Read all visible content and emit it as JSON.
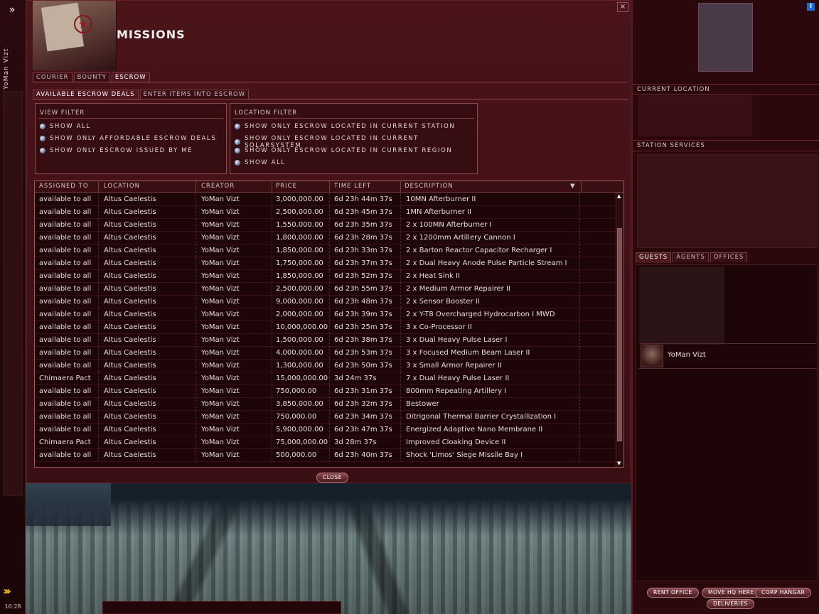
{
  "neocom": {
    "collapse_glyph": "»",
    "pilot_name": "YoMan Vizt",
    "clock": "16:28"
  },
  "window": {
    "title": "MISSIONS",
    "close_glyph": "×",
    "main_tabs": [
      {
        "label": "COURIER"
      },
      {
        "label": "BOUNTY"
      },
      {
        "label": "ESCROW"
      }
    ],
    "active_main_tab": "ESCROW",
    "sub_tabs": [
      {
        "label": "AVAILABLE ESCROW DEALS"
      },
      {
        "label": "ENTER ITEMS INTO ESCROW"
      }
    ],
    "active_sub_tab": "AVAILABLE ESCROW DEALS",
    "view_filter": {
      "title": "VIEW FILTER",
      "options": [
        "SHOW ALL",
        "SHOW ONLY AFFORDABLE ESCROW DEALS",
        "SHOW ONLY ESCROW ISSUED BY ME"
      ]
    },
    "location_filter": {
      "title": "LOCATION FILTER",
      "options": [
        "SHOW ONLY ESCROW LOCATED IN CURRENT STATION",
        "SHOW ONLY ESCROW LOCATED IN CURRENT SOLARSYSTEM",
        "SHOW ONLY ESCROW LOCATED IN CURRENT REGION",
        "SHOW ALL"
      ]
    },
    "table": {
      "columns": [
        "ASSIGNED TO",
        "LOCATION",
        "CREATOR",
        "PRICE",
        "TIME LEFT",
        "DESCRIPTION"
      ],
      "sort_glyph": "▼",
      "rows": [
        [
          "available to all",
          "Altus Caelestis",
          "YoMan Vizt",
          "3,000,000.00",
          "6d 23h 44m 37s",
          "10MN Afterburner II"
        ],
        [
          "available to all",
          "Altus Caelestis",
          "YoMan Vizt",
          "2,500,000.00",
          "6d 23h 45m 37s",
          "1MN Afterburner II"
        ],
        [
          "available to all",
          "Altus Caelestis",
          "YoMan Vizt",
          "1,550,000.00",
          "6d 23h 35m 37s",
          "2 x 100MN Afterburner I"
        ],
        [
          "available to all",
          "Altus Caelestis",
          "YoMan Vizt",
          "1,800,000.00",
          "6d 23h 28m 37s",
          "2 x 1200mm Artillery Cannon I"
        ],
        [
          "available to all",
          "Altus Caelestis",
          "YoMan Vizt",
          "1,850,000.00",
          "6d 23h 33m 37s",
          "2 x Barton Reactor Capacitor Recharger I"
        ],
        [
          "available to all",
          "Altus Caelestis",
          "YoMan Vizt",
          "1,750,000.00",
          "6d 23h 37m 37s",
          "2 x Dual Heavy Anode Pulse Particle Stream I"
        ],
        [
          "available to all",
          "Altus Caelestis",
          "YoMan Vizt",
          "1,850,000.00",
          "6d 23h 52m 37s",
          "2 x Heat Sink II"
        ],
        [
          "available to all",
          "Altus Caelestis",
          "YoMan Vizt",
          "2,500,000.00",
          "6d 23h 55m 37s",
          "2 x Medium Armor Repairer II"
        ],
        [
          "available to all",
          "Altus Caelestis",
          "YoMan Vizt",
          "9,000,000.00",
          "6d 23h 48m 37s",
          "2 x Sensor Booster II"
        ],
        [
          "available to all",
          "Altus Caelestis",
          "YoMan Vizt",
          "2,000,000.00",
          "6d 23h 39m 37s",
          "2 x Y-T8 Overcharged Hydrocarbon I MWD"
        ],
        [
          "available to all",
          "Altus Caelestis",
          "YoMan Vizt",
          "10,000,000.00",
          "6d 23h 25m 37s",
          "3 x Co-Processor II"
        ],
        [
          "available to all",
          "Altus Caelestis",
          "YoMan Vizt",
          "1,500,000.00",
          "6d 23h 38m 37s",
          "3 x Dual Heavy Pulse Laser I"
        ],
        [
          "available to all",
          "Altus Caelestis",
          "YoMan Vizt",
          "4,000,000.00",
          "6d 23h 53m 37s",
          "3 x Focused Medium Beam Laser II"
        ],
        [
          "available to all",
          "Altus Caelestis",
          "YoMan Vizt",
          "1,300,000.00",
          "6d 23h 50m 37s",
          "3 x Small Armor Repairer II"
        ],
        [
          "Chimaera Pact",
          "Altus Caelestis",
          "YoMan Vizt",
          "15,000,000.00",
          "3d 24m 37s",
          "7 x Dual Heavy Pulse Laser II"
        ],
        [
          "available to all",
          "Altus Caelestis",
          "YoMan Vizt",
          "750,000.00",
          "6d 23h 31m 37s",
          "800mm Repeating Artillery I"
        ],
        [
          "available to all",
          "Altus Caelestis",
          "YoMan Vizt",
          "3,850,000.00",
          "6d 23h 32m 37s",
          "Bestower"
        ],
        [
          "available to all",
          "Altus Caelestis",
          "YoMan Vizt",
          "750,000.00",
          "6d 23h 34m 37s",
          "Ditrigonal Thermal Barrier Crystallization I"
        ],
        [
          "available to all",
          "Altus Caelestis",
          "YoMan Vizt",
          "5,900,000.00",
          "6d 23h 47m 37s",
          "Energized Adaptive Nano Membrane II"
        ],
        [
          "Chimaera Pact",
          "Altus Caelestis",
          "YoMan Vizt",
          "75,000,000.00",
          "3d 28m 37s",
          "Improved Cloaking Device II"
        ],
        [
          "available to all",
          "Altus Caelestis",
          "YoMan Vizt",
          "500,000.00",
          "6d 23h 40m 37s",
          "Shock 'Limos' Siege Missile Bay I"
        ]
      ]
    },
    "close_button": "CLOSE"
  },
  "station": {
    "info_glyph": "i",
    "current_location_title": "CURRENT LOCATION",
    "station_services_title": "STATION SERVICES",
    "guest_tabs": [
      {
        "label": "GUESTS"
      },
      {
        "label": "AGENTS"
      },
      {
        "label": "OFFICES"
      }
    ],
    "active_guest_tab": "GUESTS",
    "guest_name": "YoMan Vizt",
    "buttons": {
      "rent_office": "RENT OFFICE",
      "move_hq": "MOVE HQ HERE",
      "corp_hangar": "CORP HANGAR",
      "deliveries": "DELIVERIES"
    }
  },
  "colors": {
    "window_bg": "#3a0f13",
    "accent_border": "#8a4a4e",
    "info_icon": "#1a6ad8",
    "neocom_chevron": "#f2c020"
  }
}
